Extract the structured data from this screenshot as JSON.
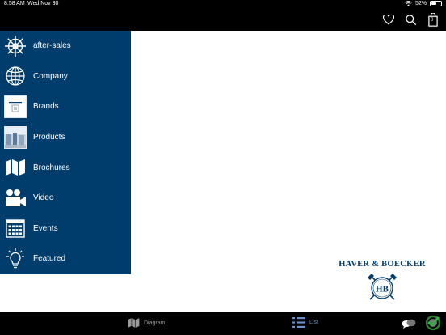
{
  "status": {
    "time": "8:58 AM",
    "date": "Wed Nov 30",
    "battery": "52%",
    "battery_level": 0.52
  },
  "toolbar": {
    "icons": [
      "heart-icon",
      "search-icon",
      "shopping-bag-icon"
    ],
    "cart_count": "0"
  },
  "sidebar": {
    "items": [
      {
        "label": "after-sales",
        "icon": "ships-wheel-icon"
      },
      {
        "label": "Company",
        "icon": "globe-icon"
      },
      {
        "label": "Brands",
        "icon": "brands-thumbnail"
      },
      {
        "label": "Products",
        "icon": "products-thumbnail"
      },
      {
        "label": "Brochures",
        "icon": "map-icon"
      },
      {
        "label": "Video",
        "icon": "video-camera-icon"
      },
      {
        "label": "Events",
        "icon": "calendar-icon"
      },
      {
        "label": "Featured",
        "icon": "lightbulb-icon"
      }
    ]
  },
  "logo": {
    "text": "HAVER & BOECKER",
    "monogram": "HB"
  },
  "bottom_tabs": [
    {
      "label": "Diagram",
      "icon": "map-icon",
      "active": false
    },
    {
      "label": "List",
      "icon": "list-icon",
      "active": true
    }
  ],
  "bottom_right_icons": [
    "chat-bubbles-icon",
    "sync-check-icon"
  ],
  "colors": {
    "sidebar": "#003c6c",
    "brand_text": "#003c6c",
    "active_tab": "#6a8fc7",
    "inactive_tab": "#999999"
  }
}
